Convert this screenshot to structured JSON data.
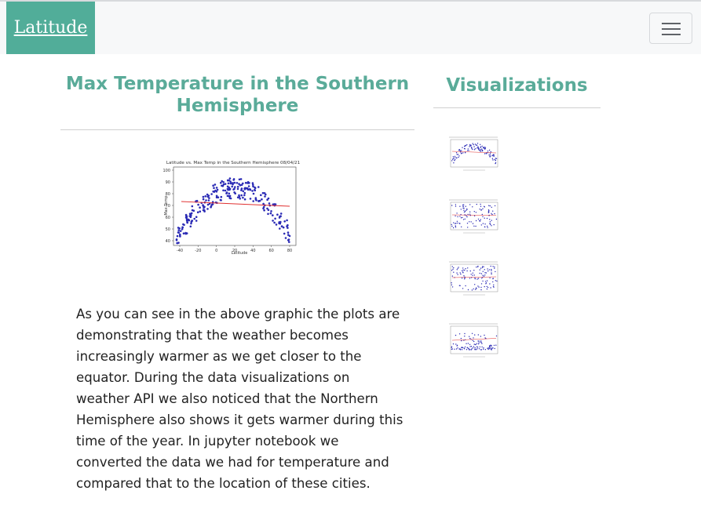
{
  "navbar": {
    "brand": "Latitude",
    "toggle_icon": "hamburger-menu-icon"
  },
  "main": {
    "title": "Max Temperature in the Southern Hemisphere",
    "paragraph": "As you can see in the above graphic the plots are demonstrating that the weather becomes increasingly warmer as we get closer to the equator. During the data visualizations on weather API we also noticed that the Northern Hemisphere also shows it gets warmer during this time of the year. In jupyter notebook we converted the data we had for temperature and compared that to the location of these cities.",
    "plot": {
      "title": "Latitude vs. Max Temp in the Southern Hemisphere 08/04/21",
      "xlabel": "Latitude",
      "ylabel": "Max Temp",
      "xticks": [
        "-40",
        "-20",
        "0",
        "20",
        "40",
        "60",
        "80"
      ],
      "yticks": [
        "40",
        "50",
        "60",
        "70",
        "80",
        "90",
        "100"
      ]
    }
  },
  "sidebar": {
    "title": "Visualizations",
    "thumbnail_count": 4
  },
  "colors": {
    "accent": "#51ad99",
    "points": "#2b2bb5",
    "regression": "#e03030"
  }
}
